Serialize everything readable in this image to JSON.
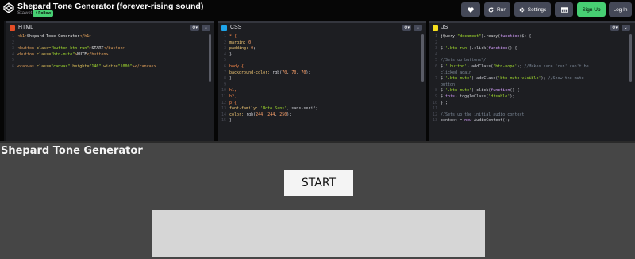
{
  "header": {
    "title": "Shepard Tone Generator (forever-rising sound)",
    "author": "Stawet",
    "follow_label": "+ Follow",
    "buttons": {
      "run": "Run",
      "settings": "Settings",
      "signup": "Sign Up",
      "login": "Log In"
    }
  },
  "panes": {
    "html": {
      "name": "HTML"
    },
    "css": {
      "name": "CSS"
    },
    "js": {
      "name": "JS"
    }
  },
  "code": {
    "html": [
      "<h1>Shepard Tone Generator</h1>",
      "",
      "<button class=\"button btn-run\">START</button>",
      "<button class=\"btn-mute\">MUTE</button>",
      "",
      "<canvas class=\"canvas\" height=\"140\" width=\"1000\"></canvas>"
    ],
    "css": [
      "* {",
      "  margin: 0;",
      "  padding: 0;",
      "}",
      "",
      "body {",
      "  background-color: rgb(70, 70, 70);",
      "}",
      "",
      "h1,",
      "h2,",
      "p {",
      "  font-family: 'Noto Sans', sans-serif;",
      "  color: rgb(244, 244, 250);",
      "}"
    ],
    "js": [
      "jQuery(\"document\").ready(function($) {",
      "",
      "  $('.btn-run').click(function() {",
      "",
      "    //Sets up buttons*/",
      "    $('.button').addClass('btn-nope'); //Makes sure 'run' can't be",
      "clicked again",
      "    $('.btn-mute').addClass('btn-mute-visible'); //Show the mute",
      "button",
      "    $('.btn-mute').click(function() {",
      "      $(this).toggleClass('disable');",
      "    });",
      "",
      "    //Sets up the initial audio context",
      "    context = new AudioContext();"
    ],
    "js_line_numbers": [
      "1",
      "2",
      "3",
      "4",
      "5",
      "6",
      "",
      "7",
      "",
      "8",
      "9",
      "10",
      "11",
      "12",
      "13"
    ]
  },
  "preview": {
    "heading": "Shepard Tone Generator",
    "start_label": "START"
  },
  "colors": {
    "accent_green": "#47cf73",
    "preview_bg": "#464646",
    "canvas_bg": "#d6d6d6"
  }
}
